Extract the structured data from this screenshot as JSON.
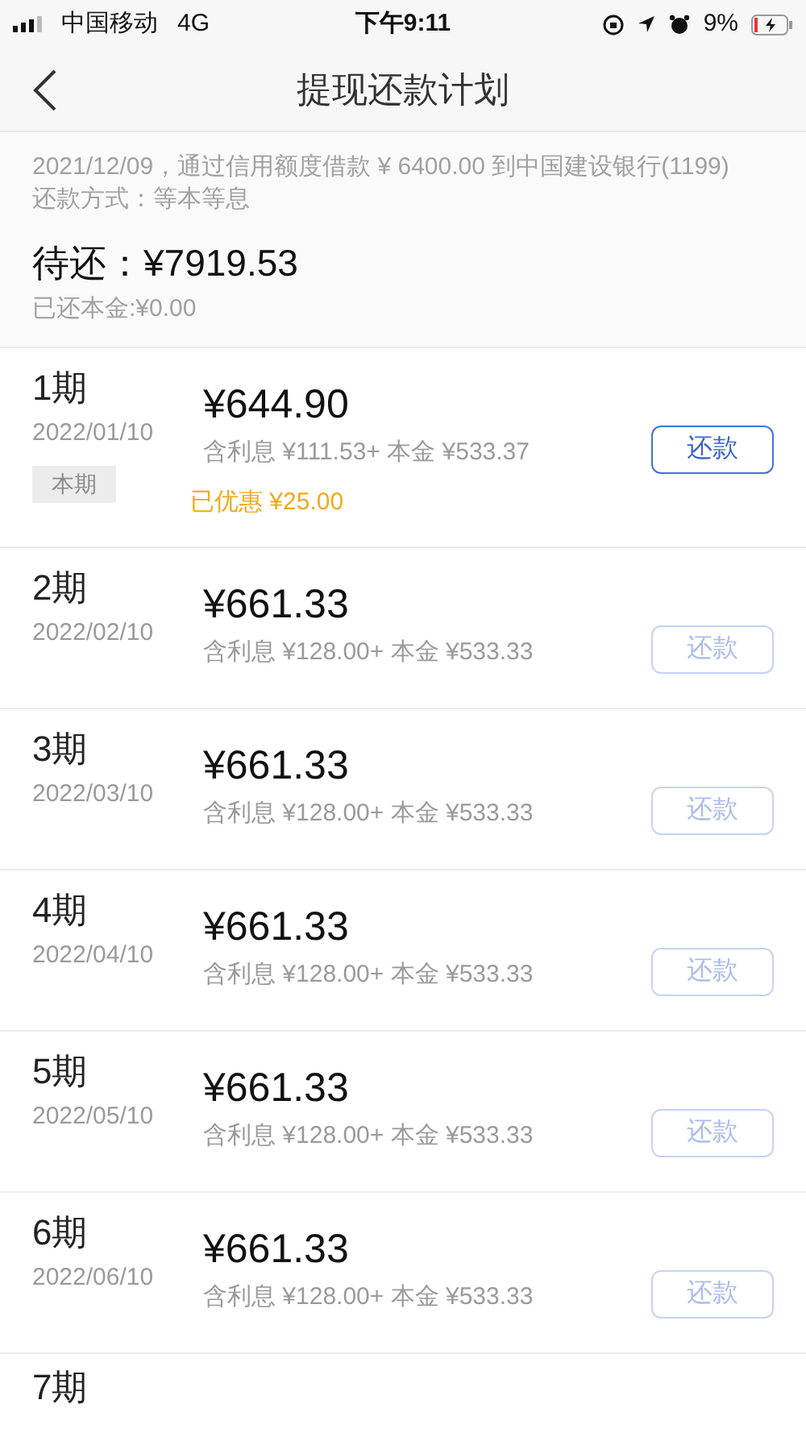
{
  "status_bar": {
    "carrier": "中国移动",
    "network": "4G",
    "time": "下午9:11",
    "battery": "9%"
  },
  "nav": {
    "title": "提现还款计划"
  },
  "summary": {
    "loan_line": "2021/12/09，通过信用额度借款 ¥ 6400.00 到中国建设银行(1199)",
    "method": "还款方式：等本等息",
    "due_label": "待还：",
    "due_amount": "¥7919.53",
    "repaid": "已还本金:¥0.00"
  },
  "installments": [
    {
      "period": "1期",
      "date": "2022/01/10",
      "amount": "¥644.90",
      "detail": "含利息 ¥111.53+ 本金 ¥533.37",
      "badge": "本期",
      "discount": "已优惠 ¥25.00",
      "button": "还款",
      "disabled": false
    },
    {
      "period": "2期",
      "date": "2022/02/10",
      "amount": "¥661.33",
      "detail": "含利息 ¥128.00+ 本金 ¥533.33",
      "button": "还款",
      "disabled": true
    },
    {
      "period": "3期",
      "date": "2022/03/10",
      "amount": "¥661.33",
      "detail": "含利息 ¥128.00+ 本金 ¥533.33",
      "button": "还款",
      "disabled": true
    },
    {
      "period": "4期",
      "date": "2022/04/10",
      "amount": "¥661.33",
      "detail": "含利息 ¥128.00+ 本金 ¥533.33",
      "button": "还款",
      "disabled": true
    },
    {
      "period": "5期",
      "date": "2022/05/10",
      "amount": "¥661.33",
      "detail": "含利息 ¥128.00+ 本金 ¥533.33",
      "button": "还款",
      "disabled": true
    },
    {
      "period": "6期",
      "date": "2022/06/10",
      "amount": "¥661.33",
      "detail": "含利息 ¥128.00+ 本金 ¥533.33",
      "button": "还款",
      "disabled": true
    },
    {
      "period": "7期"
    }
  ]
}
